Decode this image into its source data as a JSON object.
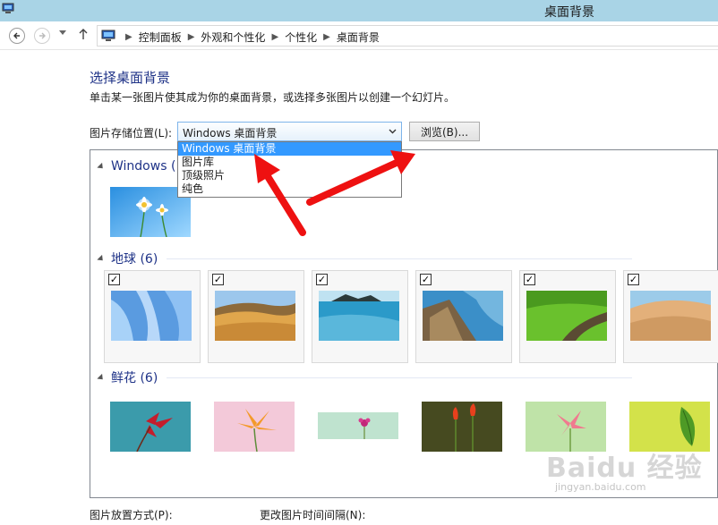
{
  "window": {
    "title": "桌面背景"
  },
  "breadcrumb": [
    "控制面板",
    "外观和个性化",
    "个性化",
    "桌面背景"
  ],
  "page": {
    "title": "选择桌面背景",
    "description": "单击某一张图片使其成为你的桌面背景，或选择多张图片以创建一个幻灯片。"
  },
  "location": {
    "label": "图片存储位置(L):",
    "value": "Windows 桌面背景",
    "options": [
      "Windows 桌面背景",
      "图片库",
      "顶级照片",
      "纯色"
    ],
    "browse_label": "浏览(B)..."
  },
  "groups": [
    {
      "name": "Windows (",
      "checkboxes": false
    },
    {
      "name": "地球 (6)",
      "checkboxes": true,
      "checked_mark": "✓"
    },
    {
      "name": "鲜花 (6)",
      "checkboxes": false
    }
  ],
  "bottom": {
    "position_label": "图片放置方式(P):",
    "interval_label": "更改图片时间间隔(N):"
  },
  "watermark": {
    "brand": "Baidu 经验",
    "sub": "jingyan.baidu.com"
  },
  "colors": {
    "titlebar": "#a9d4e6",
    "heading": "#1e3287",
    "selection": "#3399ff",
    "arrow": "#ee1111"
  }
}
